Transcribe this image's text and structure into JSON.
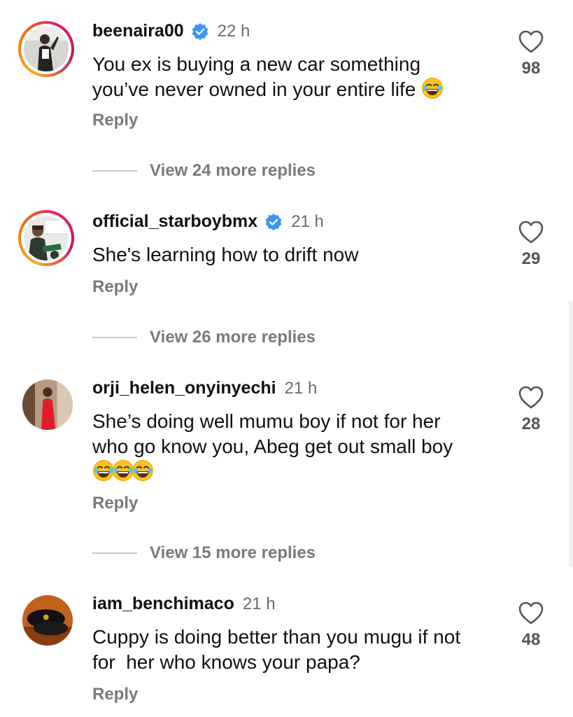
{
  "colors": {
    "verified": "#3897f0",
    "ring_start": "#f9a825",
    "ring_end": "#c2185b",
    "muted": "#7a7a7a"
  },
  "icons": {
    "verified": "verified-badge-icon",
    "like": "heart-outline-icon",
    "emoji": "laughing-tears-emoji"
  },
  "comments": [
    {
      "username": "beenaira00",
      "verified": true,
      "time": "22 h",
      "text_lines": [
        "You ex is buying a new car something",
        "you’ve never owned in your entire life"
      ],
      "likes": "98",
      "reply_label": "Reply",
      "view_replies": "View 24 more replies"
    },
    {
      "username": "official_starboybmx",
      "verified": true,
      "time": "21 h",
      "text_lines": [
        "She's learning how to drift now"
      ],
      "likes": "29",
      "reply_label": "Reply",
      "view_replies": "View 26 more replies"
    },
    {
      "username": "orji_helen_onyinyechi",
      "verified": false,
      "time": "21 h",
      "text_lines": [
        "She’s doing well mumu boy if not for her",
        "who go know you, Abeg get out small boy"
      ],
      "likes": "28",
      "reply_label": "Reply",
      "view_replies": "View 15 more replies"
    },
    {
      "username": "iam_benchimaco",
      "verified": false,
      "time": "21 h",
      "text_lines": [
        "Cuppy is doing better than you mugu if not",
        "for  her who knows your papa?"
      ],
      "likes": "48",
      "reply_label": "Reply"
    }
  ]
}
